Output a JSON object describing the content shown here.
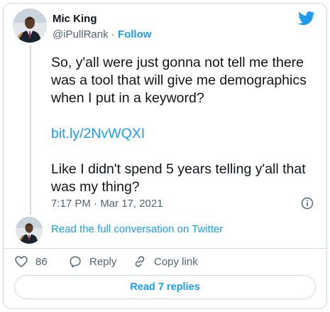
{
  "author": {
    "name": "Mic King",
    "handle": "@iPullRank",
    "separator": " · ",
    "follow_label": "Follow"
  },
  "tweet": {
    "paragraph1": "So, y'all were just gonna not tell me there was a tool that will give me demographics when I put in a keyword?",
    "link_text": "bit.ly/2NvWQXI",
    "paragraph2": "Like I didn't spend 5 years telling y'all that was my thing?",
    "timestamp": "7:17 PM · Mar 17, 2021"
  },
  "conversation": {
    "read_full_label": "Read the full conversation on Twitter"
  },
  "actions": {
    "like_count": "86",
    "reply_label": "Reply",
    "copy_link_label": "Copy link"
  },
  "replies": {
    "button_label": "Read 7 replies"
  },
  "icons": {
    "logo": "twitter-bird-icon",
    "info": "info-icon",
    "like": "heart-icon",
    "reply": "speech-bubble-icon",
    "copy": "link-icon"
  },
  "colors": {
    "accent": "#1d9bf0",
    "text": "#0f1419",
    "muted": "#536471",
    "border": "#cfd9de"
  }
}
